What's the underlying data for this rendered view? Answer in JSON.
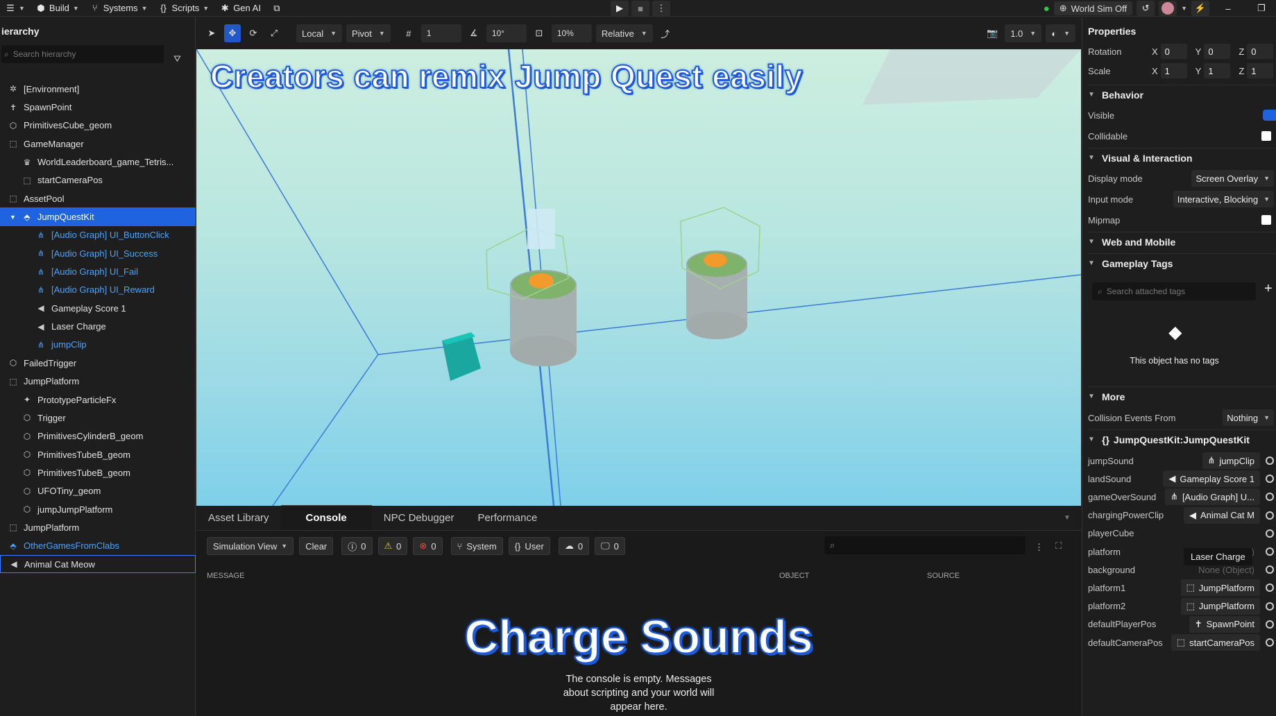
{
  "topbar": {
    "build": "Build",
    "systems": "Systems",
    "scripts": "Scripts",
    "genai": "Gen AI",
    "world_sim": "World Sim Off"
  },
  "hierarchy": {
    "title": "ierarchy",
    "search_placeholder": "Search hierarchy",
    "items": [
      {
        "label": "[Environment]",
        "indent": 0,
        "icon": "environment-icon"
      },
      {
        "label": "SpawnPoint",
        "indent": 0,
        "icon": "spawn-icon"
      },
      {
        "label": "PrimitivesCube_geom",
        "indent": 0,
        "icon": "mesh-icon"
      },
      {
        "label": "GameManager",
        "indent": 0,
        "icon": "empty-object-icon"
      },
      {
        "label": "WorldLeaderboard_game_Tetris...",
        "indent": 1,
        "icon": "trophy-icon"
      },
      {
        "label": "startCameraPos",
        "indent": 1,
        "icon": "empty-object-icon"
      },
      {
        "label": "AssetPool",
        "indent": 0,
        "icon": "empty-object-icon"
      },
      {
        "label": "JumpQuestKit",
        "indent": 1,
        "icon": "kit-icon"
      },
      {
        "label": "[Audio Graph] UI_ButtonClick",
        "indent": 2,
        "icon": "audio-graph-icon"
      },
      {
        "label": "[Audio Graph] UI_Success",
        "indent": 2,
        "icon": "audio-graph-icon"
      },
      {
        "label": "[Audio Graph] UI_Fail",
        "indent": 2,
        "icon": "audio-graph-icon"
      },
      {
        "label": "[Audio Graph] UI_Reward",
        "indent": 2,
        "icon": "audio-graph-icon"
      },
      {
        "label": "Gameplay Score 1",
        "indent": 2,
        "icon": "speaker-icon"
      },
      {
        "label": "Laser Charge",
        "indent": 2,
        "icon": "speaker-icon"
      },
      {
        "label": "jumpClip",
        "indent": 2,
        "icon": "audio-graph-icon"
      },
      {
        "label": "FailedTrigger",
        "indent": 0,
        "icon": "mesh-icon"
      },
      {
        "label": "JumpPlatform",
        "indent": 0,
        "icon": "empty-object-icon"
      },
      {
        "label": "PrototypeParticleFx",
        "indent": 1,
        "icon": "particle-icon"
      },
      {
        "label": "Trigger",
        "indent": 1,
        "icon": "mesh-icon"
      },
      {
        "label": "PrimitivesCylinderB_geom",
        "indent": 1,
        "icon": "mesh-icon"
      },
      {
        "label": "PrimitivesTubeB_geom",
        "indent": 1,
        "icon": "mesh-icon"
      },
      {
        "label": "PrimitivesTubeB_geom",
        "indent": 1,
        "icon": "mesh-icon"
      },
      {
        "label": "UFOTiny_geom",
        "indent": 1,
        "icon": "mesh-icon"
      },
      {
        "label": "jumpJumpPlatform",
        "indent": 1,
        "icon": "mesh-icon"
      },
      {
        "label": "JumpPlatform",
        "indent": 0,
        "icon": "empty-object-icon"
      },
      {
        "label": "OtherGamesFromClabs",
        "indent": 0,
        "icon": "kit-icon"
      },
      {
        "label": "Animal Cat Meow",
        "indent": 0,
        "icon": "speaker-icon"
      }
    ]
  },
  "viewport_toolbar": {
    "space": "Local",
    "pivot": "Pivot",
    "grid_value": "1",
    "angle_value": "10°",
    "scale_value": "10%",
    "relative": "Relative",
    "camera_speed": "1.0"
  },
  "viewport": {
    "caption": "Creators can remix Jump Quest easily"
  },
  "console": {
    "tabs": [
      "Asset Library",
      "Console",
      "NPC Debugger",
      "Performance"
    ],
    "view_mode": "Simulation View",
    "clear": "Clear",
    "info_count": "0",
    "warn_count": "0",
    "error_count": "0",
    "system": "System",
    "user": "User",
    "cloud_count": "0",
    "device_count": "0",
    "col_message": "MESSAGE",
    "col_object": "OBJECT",
    "col_source": "SOURCE",
    "empty_line1": "The console is empty. Messages",
    "empty_line2": "about scripting and your world will",
    "empty_line3": "appear here.",
    "caption": "Charge Sounds"
  },
  "properties": {
    "title": "Properties",
    "rotation": {
      "label": "Rotation",
      "x": "0",
      "y": "0",
      "z": "0"
    },
    "scale": {
      "label": "Scale",
      "x": "1",
      "y": "1",
      "z": "1"
    },
    "behavior": "Behavior",
    "visible": "Visible",
    "collidable": "Collidable",
    "visual": "Visual & Interaction",
    "display_mode_label": "Display mode",
    "display_mode": "Screen Overlay",
    "input_mode_label": "Input mode",
    "input_mode": "Interactive, Blocking",
    "mipmap": "Mipmap",
    "web_mobile": "Web and Mobile",
    "gameplay_tags": "Gameplay Tags",
    "tag_search": "Search attached tags",
    "no_tags": "This object has no tags",
    "more": "More",
    "collision_label": "Collision Events From",
    "collision_value": "Nothing",
    "script_title": "JumpQuestKit:JumpQuestKit",
    "script_fields": [
      {
        "label": "jumpSound",
        "value": "jumpClip",
        "icon": "audio-graph-icon"
      },
      {
        "label": "landSound",
        "value": "Gameplay Score 1",
        "icon": "speaker-icon"
      },
      {
        "label": "gameOverSound",
        "value": "[Audio Graph] U...",
        "icon": "audio-graph-icon"
      },
      {
        "label": "chargingPowerClip",
        "value": "Animal Cat M",
        "icon": "speaker-icon"
      },
      {
        "label": "playerCube",
        "value": "",
        "icon": ""
      },
      {
        "label": "platform",
        "value": "None (Object)",
        "icon": ""
      },
      {
        "label": "background",
        "value": "None (Object)",
        "icon": ""
      },
      {
        "label": "platform1",
        "value": "JumpPlatform",
        "icon": "empty-object-icon"
      },
      {
        "label": "platform2",
        "value": "JumpPlatform",
        "icon": "empty-object-icon"
      },
      {
        "label": "defaultPlayerPos",
        "value": "SpawnPoint",
        "icon": "spawn-icon"
      },
      {
        "label": "defaultCameraPos",
        "value": "startCameraPos",
        "icon": "empty-object-icon"
      }
    ],
    "tooltip": "Laser Charge"
  }
}
